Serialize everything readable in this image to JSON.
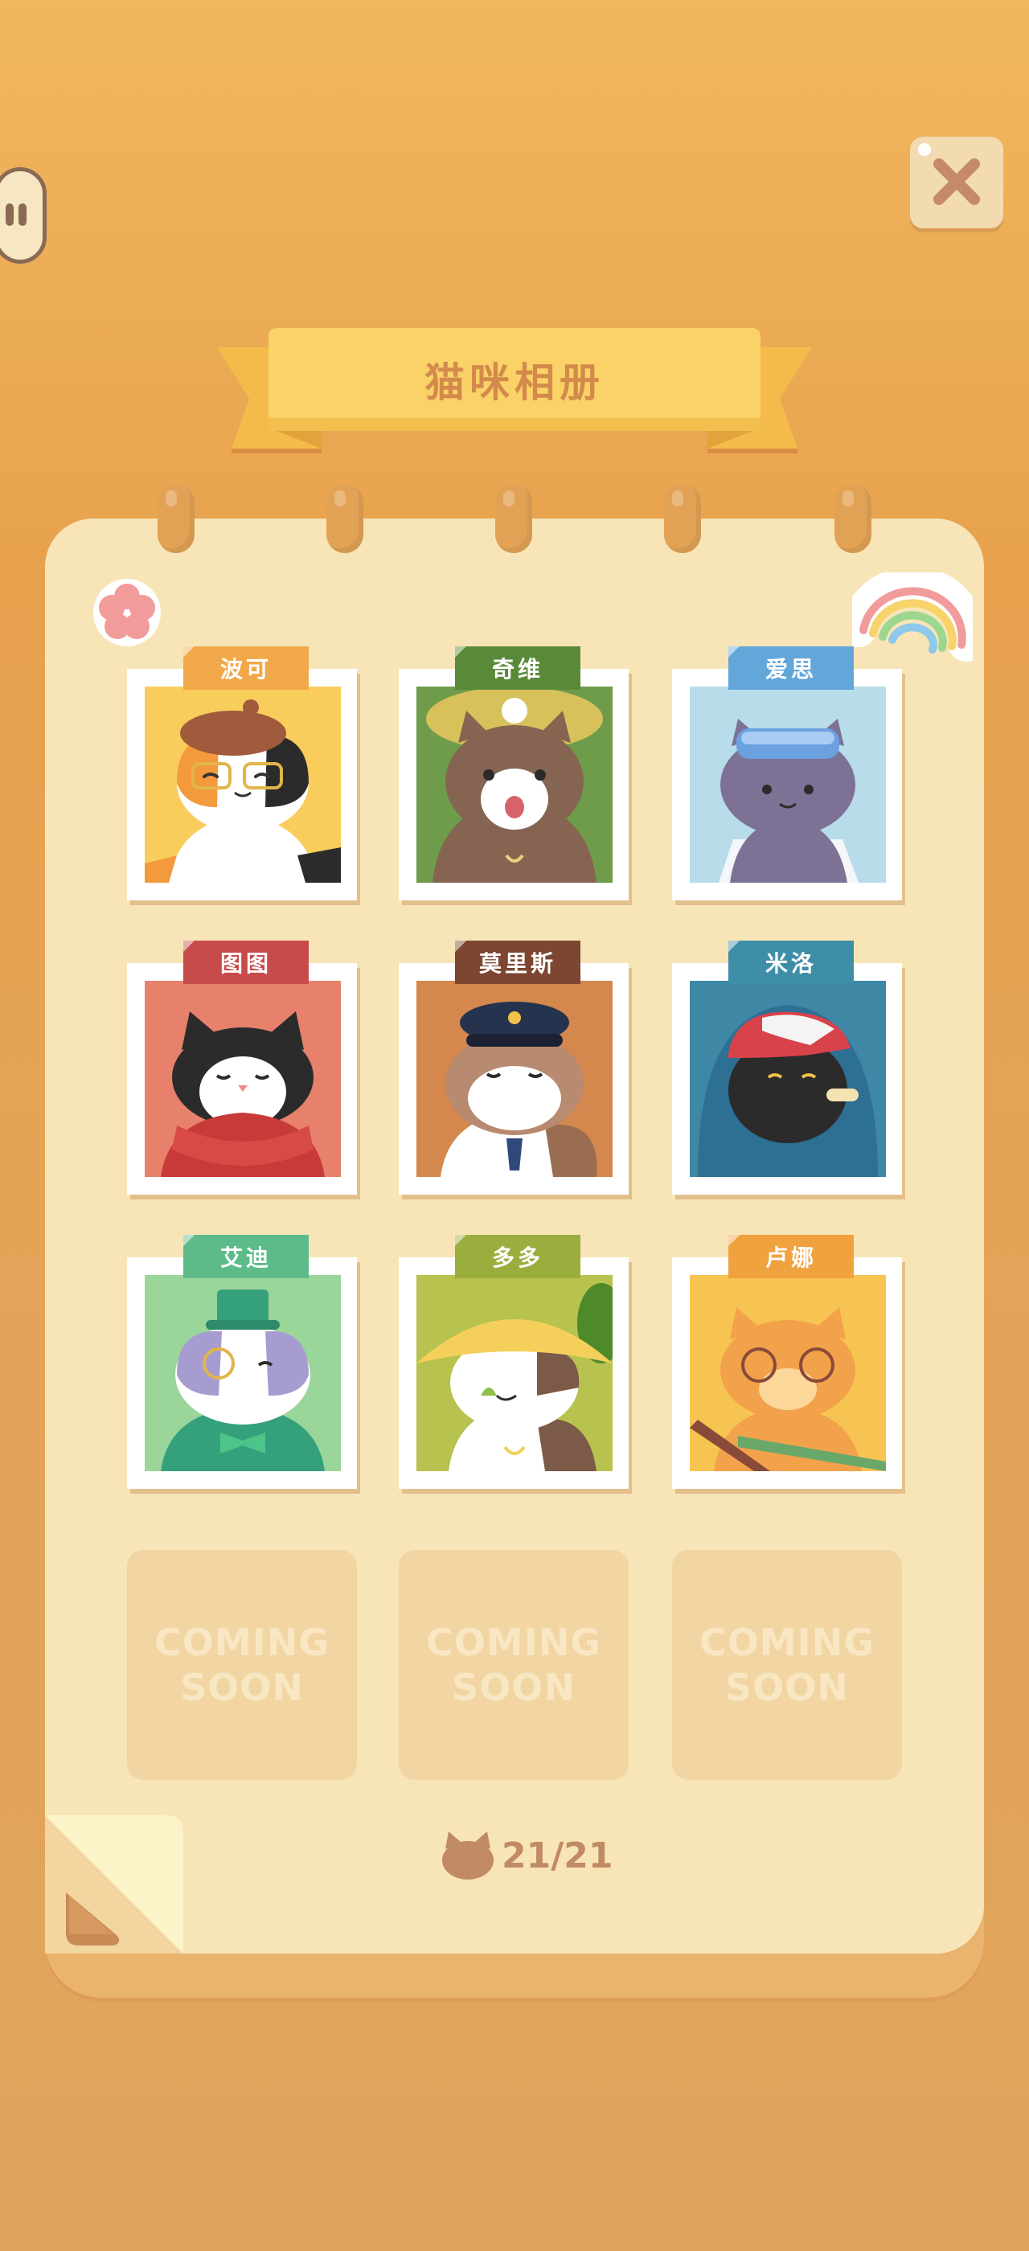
{
  "screen": {
    "title": "猫咪相册",
    "progress": {
      "collected": 21,
      "total": 21,
      "label": "21/21"
    }
  },
  "controls": {
    "pause": {
      "icon": "pause-icon"
    },
    "close": {
      "icon": "close-icon"
    }
  },
  "cats": [
    {
      "name": "波可",
      "tag_color": "#f0a84a",
      "bg": "#f8cd5c"
    },
    {
      "name": "奇维",
      "tag_color": "#5a8a38",
      "bg": "#6e9c4a"
    },
    {
      "name": "爱思",
      "tag_color": "#63a6d9",
      "bg": "#b8dce9"
    },
    {
      "name": "图图",
      "tag_color": "#c84b4b",
      "bg": "#e7816c"
    },
    {
      "name": "莫里斯",
      "tag_color": "#7c4630",
      "bg": "#d4884d"
    },
    {
      "name": "米洛",
      "tag_color": "#3e8ea8",
      "bg": "#3e88a6"
    },
    {
      "name": "艾迪",
      "tag_color": "#5dbb8a",
      "bg": "#9ad59a"
    },
    {
      "name": "多多",
      "tag_color": "#9aae3e",
      "bg": "#b8c24f"
    },
    {
      "name": "卢娜",
      "tag_color": "#f0a23e",
      "bg": "#f7c451"
    }
  ],
  "locked_slots": [
    {
      "label_line1": "COMING",
      "label_line2": "SOON"
    },
    {
      "label_line1": "COMING",
      "label_line2": "SOON"
    },
    {
      "label_line1": "COMING",
      "label_line2": "SOON"
    }
  ],
  "stickers": [
    "flower-sticker",
    "rainbow-sticker"
  ],
  "colors": {
    "accent": "#d38a4c",
    "page": "#f8e5b7",
    "background": "#e8a24e"
  }
}
